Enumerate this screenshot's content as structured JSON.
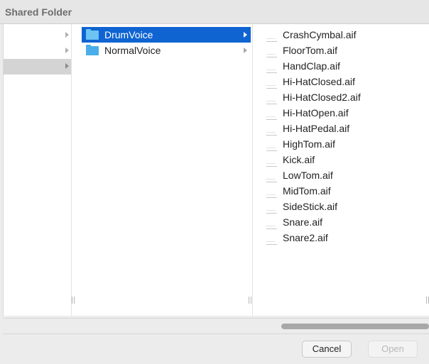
{
  "window": {
    "title": "Shared Folder"
  },
  "columns": {
    "col1": {
      "rows": [
        {
          "has_arrow": true,
          "selected": false
        },
        {
          "has_arrow": true,
          "selected": false
        },
        {
          "has_arrow": true,
          "selected": true
        }
      ]
    },
    "col2": {
      "items": [
        {
          "label": "DrumVoice",
          "icon": "folder-icon",
          "selected": true
        },
        {
          "label": "NormalVoice",
          "icon": "folder-icon",
          "selected": false
        }
      ]
    },
    "col3": {
      "files": [
        {
          "label": "CrashCymbal.aif",
          "icon": "audio-file-icon"
        },
        {
          "label": "FloorTom.aif",
          "icon": "audio-file-icon"
        },
        {
          "label": "HandClap.aif",
          "icon": "audio-file-icon"
        },
        {
          "label": "Hi-HatClosed.aif",
          "icon": "audio-file-icon"
        },
        {
          "label": "Hi-HatClosed2.aif",
          "icon": "audio-file-icon"
        },
        {
          "label": "Hi-HatOpen.aif",
          "icon": "audio-file-icon"
        },
        {
          "label": "Hi-HatPedal.aif",
          "icon": "audio-file-icon"
        },
        {
          "label": "HighTom.aif",
          "icon": "audio-file-icon"
        },
        {
          "label": "Kick.aif",
          "icon": "audio-file-icon"
        },
        {
          "label": "LowTom.aif",
          "icon": "audio-file-icon"
        },
        {
          "label": "MidTom.aif",
          "icon": "audio-file-icon"
        },
        {
          "label": "SideStick.aif",
          "icon": "audio-file-icon"
        },
        {
          "label": "Snare.aif",
          "icon": "audio-file-icon"
        },
        {
          "label": "Snare2.aif",
          "icon": "audio-file-icon"
        }
      ]
    }
  },
  "buttons": {
    "cancel_label": "Cancel",
    "open_label": "Open",
    "open_enabled": false
  },
  "colors": {
    "selection_blue": "#0f64d2",
    "folder_blue": "#4aaeea",
    "inactive_selection_gray": "#d4d4d4"
  }
}
